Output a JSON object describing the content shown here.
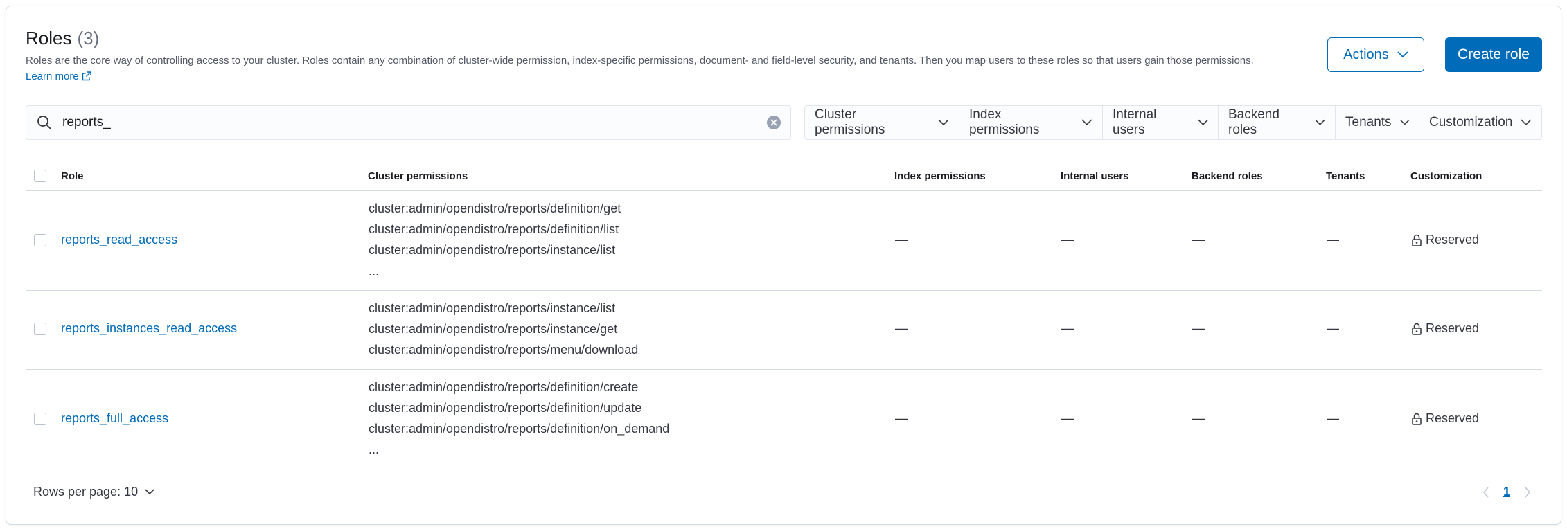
{
  "header": {
    "title": "Roles",
    "count": "(3)",
    "description": "Roles are the core way of controlling access to your cluster. Roles contain any combination of cluster-wide permission, index-specific permissions, document- and field-level security, and tenants. Then you map users to these roles so that users gain those permissions.",
    "learn_more": "Learn more",
    "actions_label": "Actions",
    "create_label": "Create role"
  },
  "search": {
    "value": "reports_"
  },
  "filters": [
    "Cluster permissions",
    "Index permissions",
    "Internal users",
    "Backend roles",
    "Tenants",
    "Customization"
  ],
  "table": {
    "columns": [
      "Role",
      "Cluster permissions",
      "Index permissions",
      "Internal users",
      "Backend roles",
      "Tenants",
      "Customization"
    ],
    "rows": [
      {
        "role": "reports_read_access",
        "cluster_permissions": [
          "cluster:admin/opendistro/reports/definition/get",
          "cluster:admin/opendistro/reports/definition/list",
          "cluster:admin/opendistro/reports/instance/list",
          "..."
        ],
        "index_permissions": "—",
        "internal_users": "—",
        "backend_roles": "—",
        "tenants": "—",
        "customization": "Reserved"
      },
      {
        "role": "reports_instances_read_access",
        "cluster_permissions": [
          "cluster:admin/opendistro/reports/instance/list",
          "cluster:admin/opendistro/reports/instance/get",
          "cluster:admin/opendistro/reports/menu/download"
        ],
        "index_permissions": "—",
        "internal_users": "—",
        "backend_roles": "—",
        "tenants": "—",
        "customization": "Reserved"
      },
      {
        "role": "reports_full_access",
        "cluster_permissions": [
          "cluster:admin/opendistro/reports/definition/create",
          "cluster:admin/opendistro/reports/definition/update",
          "cluster:admin/opendistro/reports/definition/on_demand",
          "..."
        ],
        "index_permissions": "—",
        "internal_users": "—",
        "backend_roles": "—",
        "tenants": "—",
        "customization": "Reserved"
      }
    ]
  },
  "footer": {
    "rows_per_page": "Rows per page: 10",
    "current_page": "1"
  },
  "colors": {
    "accent": "#006bb8",
    "border": "#d3dae6",
    "text": "#1a1c21"
  }
}
